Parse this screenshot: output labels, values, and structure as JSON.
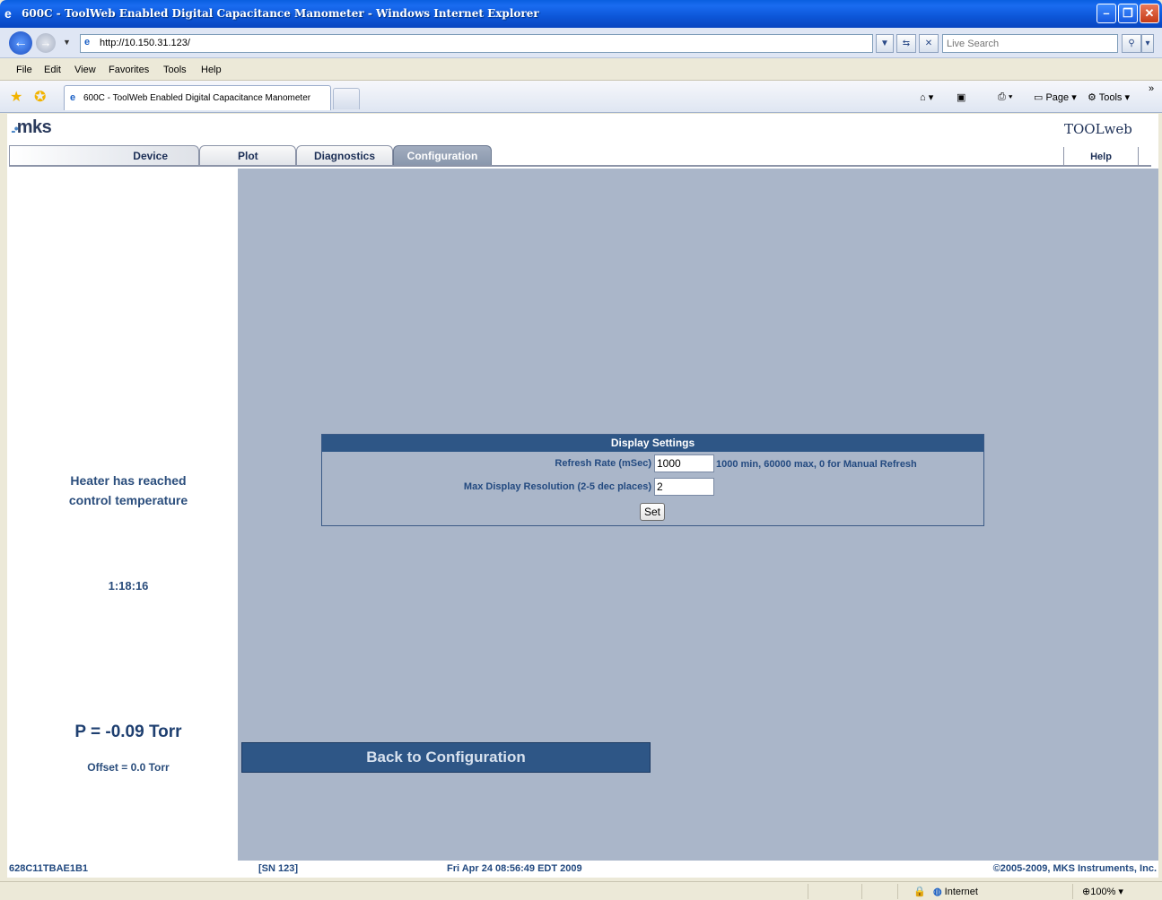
{
  "window": {
    "title": "600C - ToolWeb Enabled Digital Capacitance Manometer - Windows Internet Explorer",
    "minimize": "–",
    "restore": "❐",
    "close": "✕"
  },
  "address": {
    "url": "http://10.150.31.123/",
    "search_placeholder": "Live Search"
  },
  "menu": {
    "items": [
      "File",
      "Edit",
      "View",
      "Favorites",
      "Tools",
      "Help"
    ]
  },
  "browser_tab": {
    "label": "600C - ToolWeb Enabled Digital Capacitance Manometer"
  },
  "command_bar": {
    "page_label": "Page",
    "tools_label": "Tools"
  },
  "header": {
    "logo": "mks",
    "toolweb_logo": "TOOLweb",
    "tabs": [
      "Device",
      "Plot",
      "Diagnostics",
      "Configuration"
    ],
    "active_tab": "Configuration",
    "help": "Help"
  },
  "sidebar": {
    "status_line1": "Heater has reached",
    "status_line2": "control temperature",
    "time": "1:18:16",
    "pressure": "P = -0.09 Torr",
    "offset": "Offset = 0.0 Torr"
  },
  "display_settings": {
    "title": "Display Settings",
    "refresh_label": "Refresh Rate (mSec)",
    "refresh_value": "1000",
    "refresh_hint": "1000 min, 60000 max, 0 for Manual Refresh",
    "resolution_label": "Max Display Resolution (2-5 dec places)",
    "resolution_value": "2",
    "set_button": "Set"
  },
  "back_button": "Back to Configuration",
  "footer": {
    "device_id": "628C11TBAE1B1",
    "serial": "[SN 123]",
    "datetime": "Fri Apr 24 08:56:49 EDT 2009",
    "copyright": "©2005-2009, MKS Instruments, Inc."
  },
  "statusbar": {
    "zone": "Internet",
    "zoom": "100%"
  },
  "colors": {
    "accent": "#2e5686",
    "main_bg": "#aab6c9",
    "text_blue": "#234a80"
  }
}
